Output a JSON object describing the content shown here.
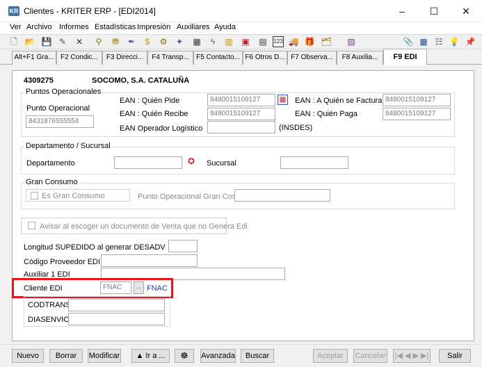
{
  "window": {
    "title": "Clientes - KRITER ERP - [EDI2014]",
    "app_icon_text": "KR",
    "controls": [
      "–",
      "☐",
      "✕"
    ]
  },
  "menu": [
    "Ver",
    "Archivo",
    "Informes",
    "Estadísticas",
    "Impresión",
    "Auxiliares",
    "Ayuda"
  ],
  "toolbar_icons": [
    "blank-page-icon",
    "open-folder-icon",
    "save-icon",
    "edit-icon",
    "delete-icon",
    "tree-icon",
    "filter-icon",
    "pen-icon",
    "dollar-icon",
    "coin-icon",
    "wand-icon",
    "calculator-icon",
    "lightning-icon",
    "bar-chart-icon",
    "camera-icon",
    "grid-icon",
    "number-icon",
    "truck-icon",
    "gift-icon",
    "tray-icon",
    "book-icon",
    "paperclip-icon",
    "keyboard-icon",
    "bullets-icon",
    "bulb-icon",
    "pin-icon"
  ],
  "toolbar_glyphs": [
    "🗋",
    "📂",
    "💾",
    "✎",
    "✕",
    "⚲",
    "⛃",
    "✒",
    "$",
    "⚙",
    "✦",
    "▦",
    "ϟ",
    "▥",
    "▣",
    "▤",
    "123",
    "🚚",
    "🎁",
    "🗂",
    "▧",
    "📎",
    "▦",
    "☷",
    "💡",
    "📌"
  ],
  "tabs": [
    "Alt+F1 Gra...",
    "F2 Condic...",
    "F3 Direcci...",
    "F4 Transp...",
    "F5 Contacto...",
    "F6 Otros D...",
    "F7 Observa...",
    "F8 Auxilia...",
    "F9 EDI"
  ],
  "header": {
    "code": "4309275",
    "name": "SOCOMO, S.A. CATALUÑA"
  },
  "puntos": {
    "legend": "Puntos Operacionales",
    "punto_label": "Punto Operacional",
    "punto_value": "8431876555554",
    "ean_pide_label": "EAN : Quién Pide",
    "ean_pide_value": "8480015109127",
    "ean_recibe_label": "EAN : Quién Recibe",
    "ean_recibe_value": "8480015109127",
    "ean_logistico_label": "EAN Operador Logístico",
    "ean_logistico_value": "",
    "insdes": "(INSDES)",
    "ean_factura_label": "EAN : A Quién se Factura",
    "ean_factura_value": "8480015109127",
    "ean_paga_label": "EAN : Quién Paga",
    "ean_paga_value": "8480015109127"
  },
  "departamento": {
    "legend": "Departamento / Sucursal",
    "dep_label": "Departamento",
    "dep_value": "",
    "suc_label": "Sucursal",
    "suc_value": ""
  },
  "gran_consumo": {
    "legend": "Gran Consumo",
    "check_label": "Es Gran Consumo",
    "punto_label": "Punto Operacional Gran Cosumo",
    "punto_value": ""
  },
  "avisar_label": "Avisar al escoger un documento de Venta que no Genera Edi",
  "longitud_label": "Longitud SUPEDIDO al generar DESADV",
  "longitud_value": "",
  "codigo_label": "Código Proveedor EDI",
  "codigo_value": "",
  "auxiliar_label": "Auxiliar 1 EDI",
  "auxiliar_value": "",
  "cliente_edi": {
    "label": "Cliente EDI",
    "value": "FNAC",
    "browse": "...",
    "link": "FNAC"
  },
  "codtrans_label": "CODTRANS",
  "codtrans_value": "",
  "diasenvio_label": "DIASENVIO",
  "diasenvio_value": "",
  "buttons": {
    "nuevo": "Nuevo",
    "borrar": "Borrar",
    "modificar": "Modificar",
    "ira": "▲ Ir a ...",
    "fingerprint": "☸",
    "avanzada": "Avanzada",
    "buscar": "Buscar",
    "aceptar": "Aceptar",
    "cancelar": "Cancelar",
    "nav": "|◀ ◀ ▶ ▶|",
    "salir": "Salir"
  },
  "colors": {
    "accent_link": "#1a3dbf",
    "highlight": "#e8141c",
    "icon_red": "#d02020"
  }
}
